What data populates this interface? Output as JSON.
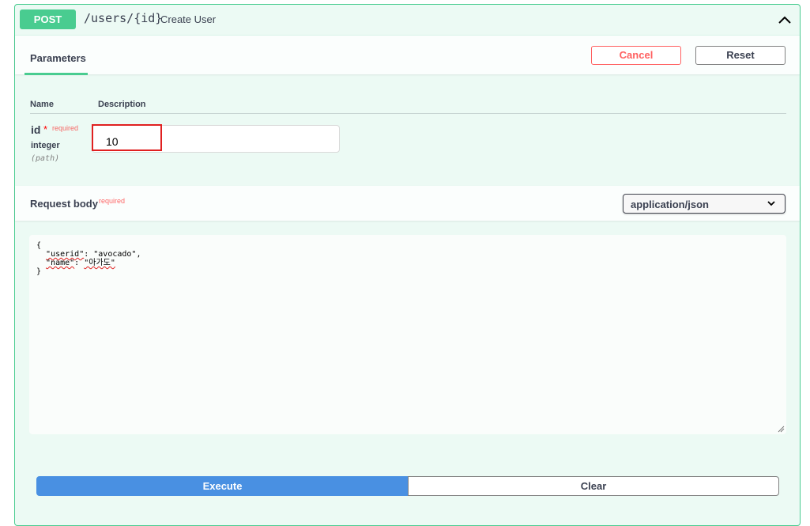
{
  "operation": {
    "method": "POST",
    "path": "/users/{id}",
    "description": "Create User"
  },
  "parameters": {
    "tab_label": "Parameters",
    "cancel_label": "Cancel",
    "reset_label": "Reset",
    "col_name": "Name",
    "col_description": "Description",
    "items": [
      {
        "name": "id",
        "required_star": "*",
        "required_label": "required",
        "type": "integer",
        "in": "(path)",
        "value": "10"
      }
    ]
  },
  "request_body": {
    "title": "Request body",
    "required_label": "required",
    "content_type": "application/json",
    "code": {
      "line1": "{",
      "line2_indent": "  ",
      "userid_key": "\"userid\"",
      "userid_sep": ": ",
      "userid_value": "\"avocado\",",
      "line3_indent": "  ",
      "name_key": "\"name\"",
      "name_sep": ": ",
      "name_value": "\"아가도\"",
      "line4": "}"
    }
  },
  "actions": {
    "execute_label": "Execute",
    "clear_label": "Clear"
  },
  "colors": {
    "post": "#49cc90",
    "execute": "#4990e2",
    "cancel": "#ff6060",
    "highlight": "#e02020"
  }
}
